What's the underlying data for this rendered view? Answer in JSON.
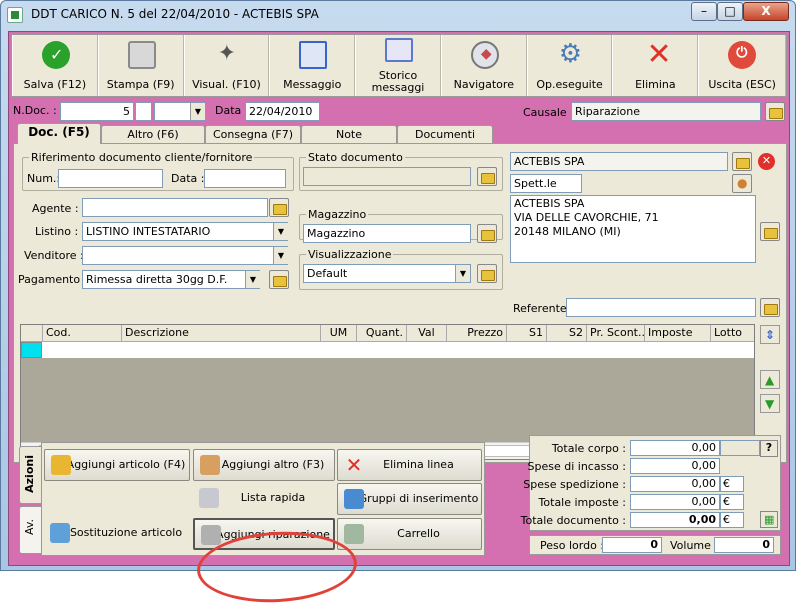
{
  "window": {
    "title": "DDT CARICO N. 5  del 22/04/2010 - ACTEBIS SPA",
    "min": "–",
    "max": "□",
    "close": "X"
  },
  "toolbar": [
    {
      "label": "Salva (F12)",
      "icon": "check-icon",
      "color": "#2aa12a"
    },
    {
      "label": "Stampa (F9)",
      "icon": "printer-icon",
      "color": "#8a8a8a"
    },
    {
      "label": "Visual. (F10)",
      "icon": "magic-wand-icon",
      "color": "#555555"
    },
    {
      "label": "Messaggio",
      "icon": "pen-message-icon",
      "color": "#3a64c8"
    },
    {
      "label": "Storico messaggi",
      "icon": "search-message-icon",
      "color": "#5a7ad0"
    },
    {
      "label": "Navigatore",
      "icon": "compass-icon",
      "color": "#c84a4a"
    },
    {
      "label": "Op.eseguite",
      "icon": "gears-icon",
      "color": "#4a7ab8"
    },
    {
      "label": "Elimina",
      "icon": "delete-x-icon",
      "color": "#e0302a"
    },
    {
      "label": "Uscita (ESC)",
      "icon": "exit-icon",
      "color": "#e04a3a"
    }
  ],
  "header": {
    "ndoc_label": "N.Doc. :",
    "ndoc_value": "5",
    "data_label": "Data :",
    "data_value": "22/04/2010",
    "causale_label": "Causale :",
    "causale_value": "Riparazione"
  },
  "tabs": [
    "Doc. (F5)",
    "Altro (F6)",
    "Consegna (F7)",
    "Note",
    "Documenti"
  ],
  "riferimento": {
    "title": "Riferimento documento cliente/fornitore",
    "num_label": "Num.:",
    "data_label": "Data :"
  },
  "stato": {
    "title": "Stato documento"
  },
  "magazzino": {
    "title": "Magazzino",
    "value": "Magazzino"
  },
  "visualizzazione": {
    "title": "Visualizzazione",
    "value": "Default"
  },
  "fields": {
    "agente_label": "Agente :",
    "listino_label": "Listino :",
    "listino_value": "LISTINO INTESTATARIO",
    "venditore_label": "Venditore :",
    "pagamento_label": "Pagamento :",
    "pagamento_value": "Rimessa diretta 30gg D.F."
  },
  "cliente": {
    "name": "ACTEBIS SPA",
    "spett": "Spett.le",
    "address": [
      "ACTEBIS SPA",
      "VIA DELLE CAVORCHIE, 71",
      "20148 MILANO (MI)"
    ],
    "referente_label": "Referente"
  },
  "grid": {
    "columns": [
      "",
      "Cod.",
      "Descrizione",
      "UM",
      "Quant.",
      "Val",
      "Prezzo",
      "S1",
      "S2",
      "Pr. Scont...",
      "Imposte",
      "Lotto"
    ]
  },
  "actions": {
    "tab_azioni": "Azioni",
    "tab_av": "Av.",
    "buttons": [
      "Aggiungi articolo (F4)",
      "Aggiungi altro (F3)",
      "Elimina linea",
      "Lista rapida",
      "Gruppi di inserimento",
      "Sostituzione articolo",
      "Aggiungi riparazione",
      "Carrello"
    ]
  },
  "totals": {
    "rows": [
      {
        "label": "Totale corpo :",
        "value": "0,00",
        "cur": ""
      },
      {
        "label": "Spese di incasso :",
        "value": "0,00",
        "cur": ""
      },
      {
        "label": "Spese spedizione :",
        "value": "0,00",
        "cur": "€"
      },
      {
        "label": "Totale imposte :",
        "value": "0,00",
        "cur": "€"
      },
      {
        "label": "Totale documento :",
        "value": "0,00",
        "cur": "€"
      }
    ],
    "help": "?",
    "peso_label": "Peso lordo :",
    "peso_value": "0",
    "volume_label": "Volume :",
    "volume_value": "0"
  }
}
